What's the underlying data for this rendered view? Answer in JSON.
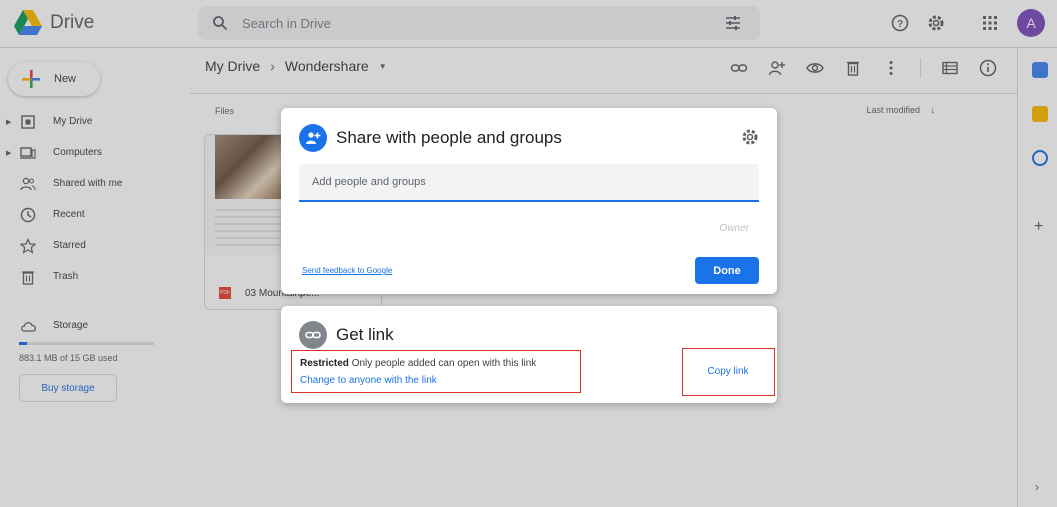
{
  "app": {
    "name": "Drive",
    "avatar_letter": "A",
    "avatar_color": "#7c4dbd",
    "accent": "#1a73e8",
    "highlight": "#d93025"
  },
  "search": {
    "placeholder": "Search in Drive"
  },
  "sidebar": {
    "new_label": "New",
    "items": [
      {
        "label": "My Drive",
        "icon": "drive-folder-icon",
        "expandable": true
      },
      {
        "label": "Computers",
        "icon": "computer-icon",
        "expandable": true
      },
      {
        "label": "Shared with me",
        "icon": "shared-people-icon",
        "expandable": false
      },
      {
        "label": "Recent",
        "icon": "clock-icon",
        "expandable": false
      },
      {
        "label": "Starred",
        "icon": "star-icon",
        "expandable": false
      },
      {
        "label": "Trash",
        "icon": "trash-icon",
        "expandable": false
      }
    ],
    "storage_label": "Storage",
    "storage_used": "883.1 MB of 15 GB used",
    "storage_fraction": 0.06,
    "buy_label": "Buy storage"
  },
  "main": {
    "breadcrumb_root": "My Drive",
    "breadcrumb_current": "Wondershare",
    "files_label": "Files",
    "sort_label": "Last modified",
    "file_name": "03 Mountainpe..."
  },
  "share_dialog": {
    "title": "Share with people and groups",
    "input_placeholder": "Add people and groups",
    "owner_label": "Owner",
    "feedback_link": "Send feedback to Google",
    "done_label": "Done"
  },
  "get_link_dialog": {
    "title": "Get link",
    "restriction_bold": "Restricted",
    "restriction_text": "Only people added can open with this link",
    "change_link": "Change to anyone with the link",
    "copy_label": "Copy link"
  }
}
